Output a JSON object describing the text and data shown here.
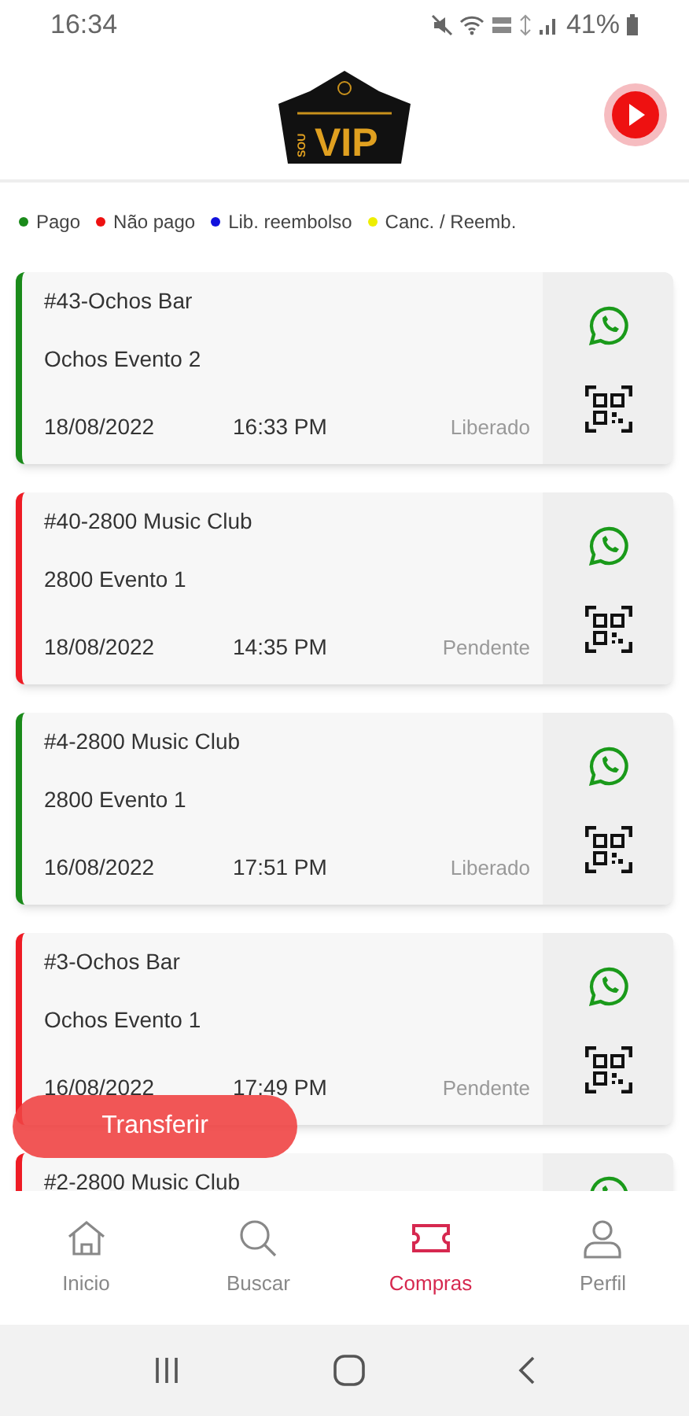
{
  "status_bar": {
    "time": "16:34",
    "battery": "41%"
  },
  "header": {
    "logo": {
      "small": "SOU",
      "main": "VIP"
    }
  },
  "legend": [
    {
      "label": "Pago",
      "color": "#1a8a1a"
    },
    {
      "label": "Não pago",
      "color": "#ee1111"
    },
    {
      "label": "Lib. reembolso",
      "color": "#1111dd"
    },
    {
      "label": "Canc. / Reemb.",
      "color": "#eeee00"
    }
  ],
  "purchases": [
    {
      "title": "#43-Ochos Bar",
      "event": "Ochos Evento 2",
      "date": "18/08/2022",
      "time": "16:33 PM",
      "status": "Liberado",
      "color": "#1a8a1a"
    },
    {
      "title": "#40-2800 Music Club",
      "event": "2800 Evento 1",
      "date": "18/08/2022",
      "time": "14:35 PM",
      "status": "Pendente",
      "color": "#ee1c25"
    },
    {
      "title": "#4-2800 Music Club",
      "event": "2800 Evento 1",
      "date": "16/08/2022",
      "time": "17:51 PM",
      "status": "Liberado",
      "color": "#1a8a1a"
    },
    {
      "title": "#3-Ochos Bar",
      "event": "Ochos Evento 1",
      "date": "16/08/2022",
      "time": "17:49 PM",
      "status": "Pendente",
      "color": "#ee1c25"
    },
    {
      "title": "#2-2800 Music Club",
      "color": "#ee1c25"
    }
  ],
  "transfer_button": {
    "label": "Transferir"
  },
  "bottom_nav": [
    {
      "label": "Inicio",
      "kind": "home",
      "selected": false
    },
    {
      "label": "Buscar",
      "kind": "search",
      "selected": false
    },
    {
      "label": "Compras",
      "kind": "ticket",
      "selected": true
    },
    {
      "label": "Perfil",
      "kind": "user",
      "selected": false
    }
  ]
}
